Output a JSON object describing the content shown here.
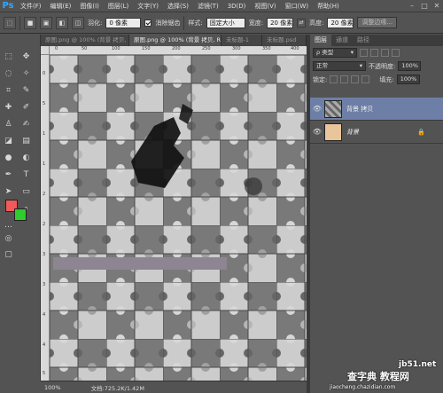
{
  "app": {
    "logo": "Ps"
  },
  "menu": [
    "文件(F)",
    "编辑(E)",
    "图像(I)",
    "图层(L)",
    "文字(Y)",
    "选择(S)",
    "滤镜(T)",
    "3D(D)",
    "视图(V)",
    "窗口(W)",
    "帮助(H)"
  ],
  "window_controls": {
    "minimize": "–",
    "maximize": "□",
    "close": "✕"
  },
  "options": {
    "feather_label": "羽化:",
    "feather_value": "0 像素",
    "antialias_label": "消除锯齿",
    "style_label": "样式:",
    "style_value": "固定大小",
    "width_label": "宽度:",
    "width_value": "20 像素",
    "height_label": "高度:",
    "height_value": "20 像素",
    "refine_button": "调整边缘..."
  },
  "tabs": [
    {
      "label": "原图.png @ 100% (背景 拷贝, RGB/8#) *",
      "active": false
    },
    {
      "label": "原图.png @ 100% (背景 拷贝, RGB/8#) *",
      "active": true
    },
    {
      "label": "未标题-1",
      "active": false
    },
    {
      "label": "未标题.psd",
      "active": false
    }
  ],
  "ruler": {
    "top_ticks": [
      "0",
      "50",
      "100",
      "150",
      "200",
      "250",
      "300",
      "350",
      "400"
    ],
    "left_ticks": [
      "0",
      "5",
      "1",
      "1",
      "2",
      "2",
      "3",
      "3",
      "4",
      "4",
      "5"
    ]
  },
  "status": {
    "zoom": "100%",
    "doc": "文档:725.2K/1.42M"
  },
  "layers_panel": {
    "tabs": [
      "图层",
      "通道",
      "路径"
    ],
    "filter_label": "ρ 类型",
    "blend_mode": "正常",
    "opacity_label": "不透明度:",
    "opacity_value": "100%",
    "lock_label": "锁定:",
    "fill_label": "填充:",
    "fill_value": "100%",
    "layers": [
      {
        "name": "背景 拷贝",
        "selected": true,
        "visible": true
      },
      {
        "name": "背景",
        "selected": false,
        "visible": true,
        "locked": true
      }
    ]
  },
  "watermarks": {
    "site": "jb51.net",
    "brand": "查字典 教程网",
    "url": "jiaocheng.chazidian.com"
  },
  "colors": {
    "foreground": "#f05a5a",
    "background": "#2ecc2e",
    "layer_selected": "#6d7fa6"
  }
}
